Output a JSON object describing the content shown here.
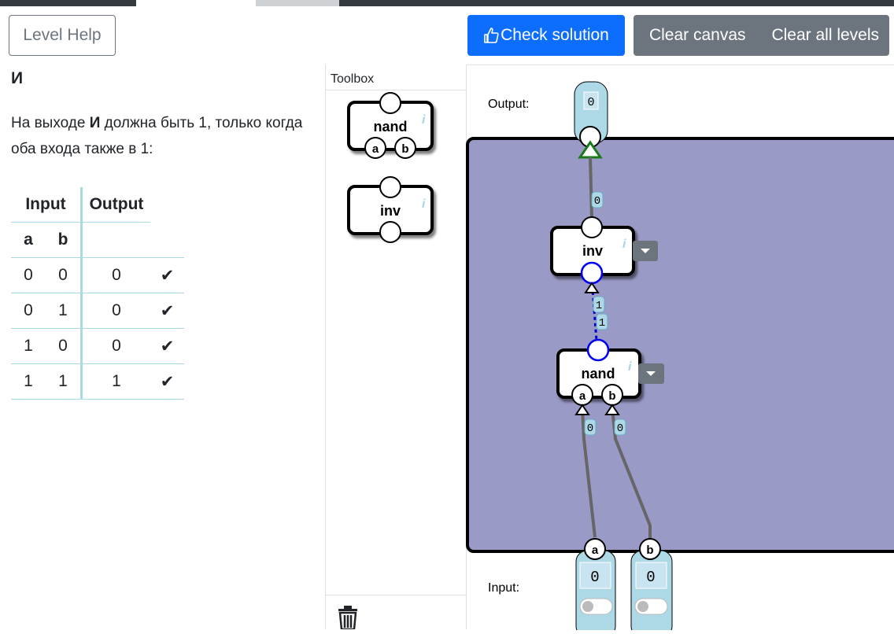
{
  "header": {
    "level_help": "Level Help",
    "check_solution": "Check solution",
    "clear_canvas": "Clear canvas",
    "clear_all_levels": "Clear all levels"
  },
  "level": {
    "title": "И",
    "desc_prefix": "На выходе ",
    "desc_bold": "И",
    "desc_suffix": " должна быть 1, только когда оба входа также в 1:"
  },
  "truth_table": {
    "input_header": "Input",
    "output_header": "Output",
    "col_a": "a",
    "col_b": "b",
    "rows": [
      {
        "a": "0",
        "b": "0",
        "out": "0",
        "check": "✔"
      },
      {
        "a": "0",
        "b": "1",
        "out": "0",
        "check": "✔"
      },
      {
        "a": "1",
        "b": "0",
        "out": "0",
        "check": "✔"
      },
      {
        "a": "1",
        "b": "1",
        "out": "1",
        "check": "✔"
      }
    ]
  },
  "toolbox": {
    "title": "Toolbox",
    "nand_label": "nand",
    "inv_label": "inv",
    "port_a": "a",
    "port_b": "b",
    "info": "i"
  },
  "canvas": {
    "output_label": "Output:",
    "input_label": "Input:",
    "output_value": "0",
    "inv_label": "inv",
    "nand_label": "nand",
    "info": "i",
    "port_a": "a",
    "port_b": "b",
    "wire_out_value": "0",
    "wire_mid_value_1": "1",
    "wire_mid_value_2": "1",
    "wire_a_value": "0",
    "wire_b_value": "0",
    "input_a_value": "0",
    "input_b_value": "0",
    "input_a_label": "a",
    "input_b_label": "b",
    "board_color": "#9a9ac6"
  }
}
